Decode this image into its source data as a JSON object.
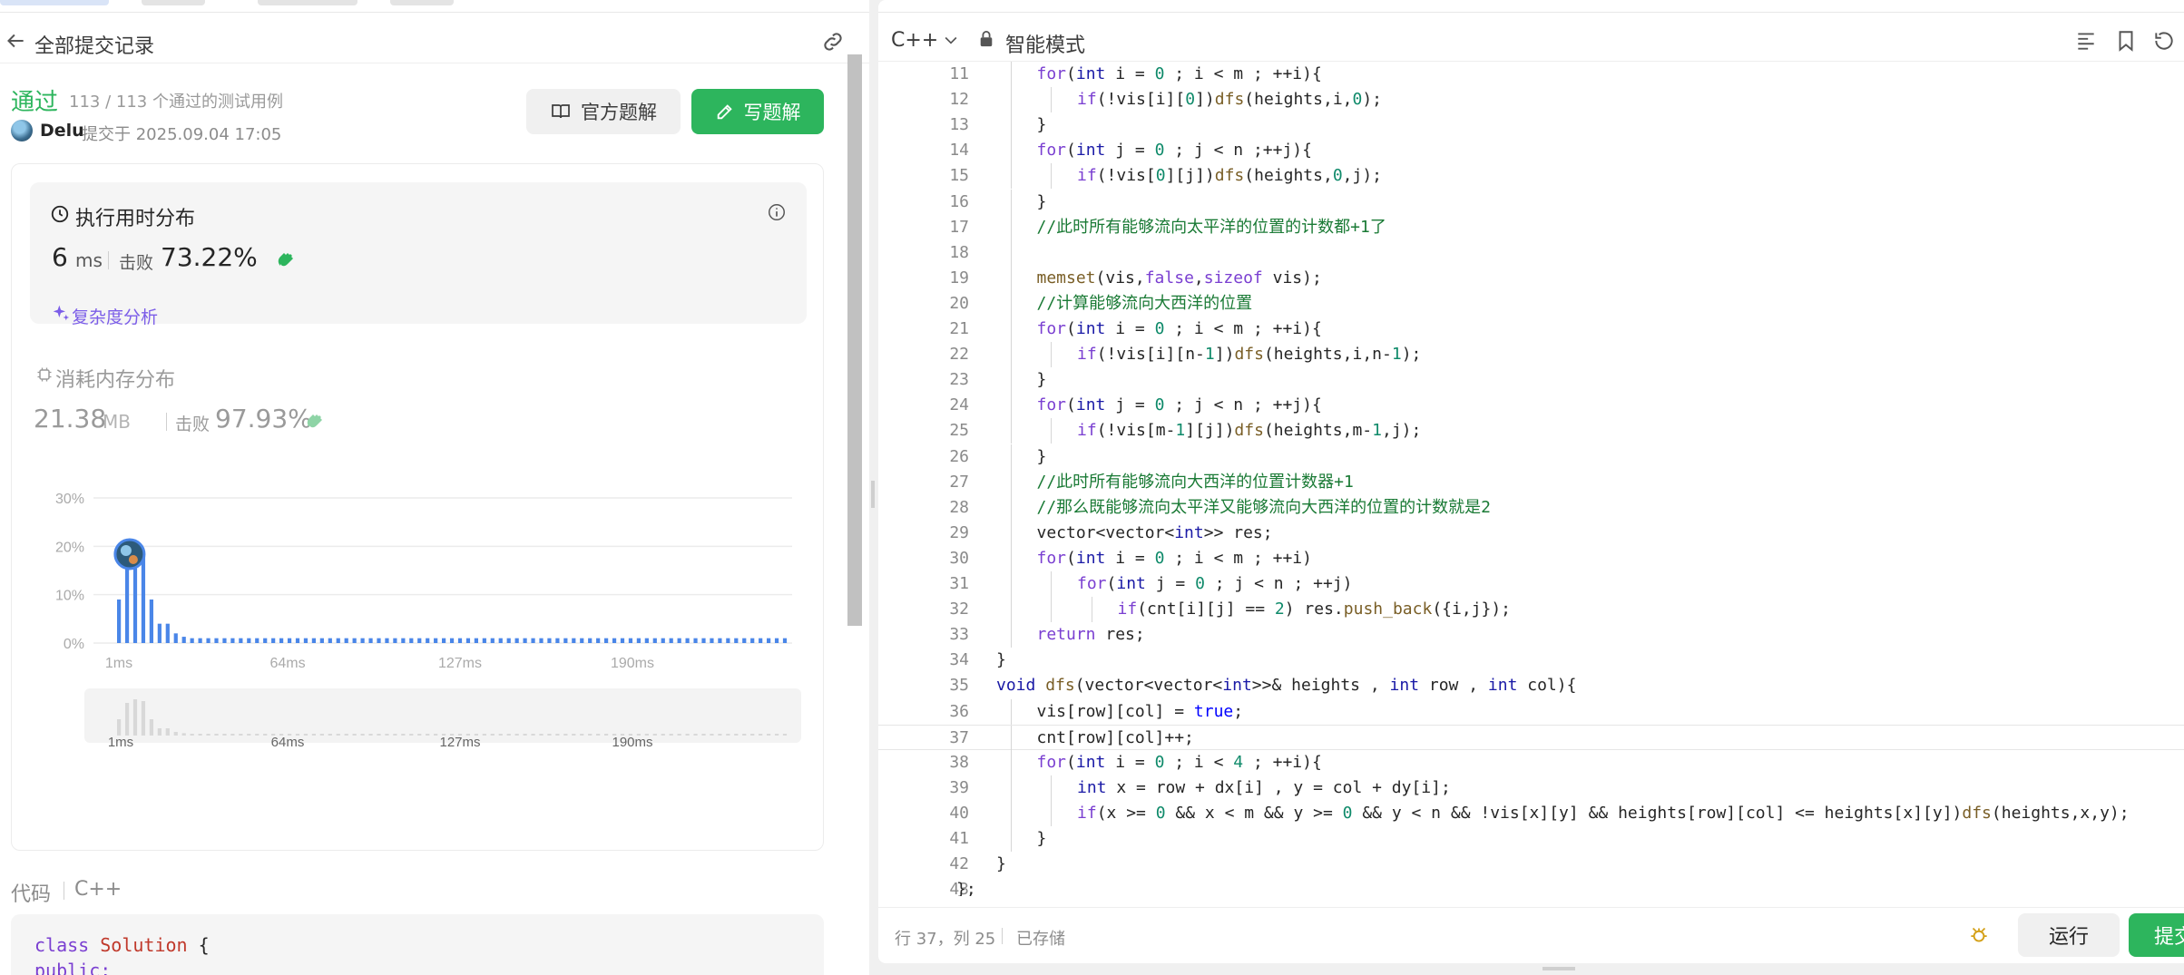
{
  "left": {
    "header_title": "全部提交记录",
    "status": "通过",
    "cases": "113 / 113 个通过的测试用例",
    "user": "Delu",
    "submitted": "提交于 2025.09.04 17:05",
    "btn_official": "官方题解",
    "btn_write": "写题解",
    "runtime": {
      "title": "执行用时分布",
      "value": "6",
      "unit": "ms",
      "beat_label": "击败",
      "beat_pct": "73.22%",
      "complexity": "复杂度分析"
    },
    "memory": {
      "title": "消耗内存分布",
      "value": "21.38",
      "unit": "MB",
      "beat_label": "击败",
      "beat_pct": "97.93%"
    },
    "code_label": "代码",
    "code_lang": "C++",
    "code_preview": [
      "class Solution {",
      "public:"
    ]
  },
  "chart_data": {
    "type": "bar",
    "title": "",
    "xlabel": "",
    "ylabel": "",
    "ylim": [
      0,
      30
    ],
    "y_ticks": [
      "30%",
      "20%",
      "10%",
      "0%"
    ],
    "x_ticks": [
      "1ms",
      "64ms",
      "127ms",
      "190ms"
    ],
    "x_min": 1,
    "x_max": 250,
    "bar_color": "#4a86e8",
    "highlight_ms": 6,
    "values": [
      9,
      18,
      20,
      19,
      9,
      4,
      4,
      2,
      1.3,
      1,
      1,
      1,
      1,
      1,
      1,
      1,
      1,
      1,
      1,
      1,
      1,
      1,
      1,
      1,
      1,
      1,
      1,
      1,
      1,
      1,
      1,
      1,
      1,
      1,
      1,
      1,
      1,
      1,
      1,
      1,
      1,
      1,
      1,
      1,
      1,
      1,
      1,
      1,
      1,
      1,
      1,
      1,
      1,
      1,
      1,
      1,
      1,
      1,
      1,
      1,
      1,
      1,
      1,
      1,
      1,
      1,
      1,
      1,
      1,
      1,
      1,
      1,
      1,
      1,
      1,
      1,
      1,
      1,
      1,
      1,
      1,
      1,
      1
    ],
    "overview_x_ticks": [
      "1ms",
      "64ms",
      "127ms",
      "190ms"
    ]
  },
  "editor": {
    "language": "C++",
    "mode": "智能模式",
    "status_position": "行 37，列 25",
    "status_saved": "已存储",
    "btn_run": "运行",
    "btn_submit": "提交",
    "active_line": 37,
    "lines": [
      {
        "n": "11",
        "indent": 2,
        "parts": [
          [
            "kw",
            "for"
          ],
          [
            "t",
            "("
          ],
          [
            "typ",
            "int"
          ],
          [
            "t",
            " i = "
          ],
          [
            "num",
            "0"
          ],
          [
            "t",
            " ; i < m ; ++i){"
          ]
        ]
      },
      {
        "n": "12",
        "indent": 3,
        "parts": [
          [
            "kw",
            "if"
          ],
          [
            "t",
            "(!vis[i]["
          ],
          [
            "num",
            "0"
          ],
          [
            "t",
            "])"
          ],
          [
            "fn",
            "dfs"
          ],
          [
            "t",
            "(heights,i,"
          ],
          [
            "num",
            "0"
          ],
          [
            "t",
            ");"
          ]
        ]
      },
      {
        "n": "13",
        "indent": 2,
        "parts": [
          [
            "t",
            "}"
          ]
        ]
      },
      {
        "n": "14",
        "indent": 2,
        "parts": [
          [
            "kw",
            "for"
          ],
          [
            "t",
            "("
          ],
          [
            "typ",
            "int"
          ],
          [
            "t",
            " j = "
          ],
          [
            "num",
            "0"
          ],
          [
            "t",
            " ; j < n ;++j){"
          ]
        ]
      },
      {
        "n": "15",
        "indent": 3,
        "parts": [
          [
            "kw",
            "if"
          ],
          [
            "t",
            "(!vis["
          ],
          [
            "num",
            "0"
          ],
          [
            "t",
            "][j])"
          ],
          [
            "fn",
            "dfs"
          ],
          [
            "t",
            "(heights,"
          ],
          [
            "num",
            "0"
          ],
          [
            "t",
            ",j);"
          ]
        ]
      },
      {
        "n": "16",
        "indent": 2,
        "parts": [
          [
            "t",
            "}"
          ]
        ]
      },
      {
        "n": "17",
        "indent": 2,
        "parts": [
          [
            "cm",
            "//此时所有能够流向太平洋的位置的计数都+1了"
          ]
        ]
      },
      {
        "n": "18",
        "indent": 2,
        "parts": []
      },
      {
        "n": "19",
        "indent": 2,
        "parts": [
          [
            "fn",
            "memset"
          ],
          [
            "t",
            "(vis,"
          ],
          [
            "kw",
            "false"
          ],
          [
            "t",
            ","
          ],
          [
            "kw",
            "sizeof"
          ],
          [
            "t",
            " vis);"
          ]
        ]
      },
      {
        "n": "20",
        "indent": 2,
        "parts": [
          [
            "cm",
            "//计算能够流向大西洋的位置"
          ]
        ]
      },
      {
        "n": "21",
        "indent": 2,
        "parts": [
          [
            "kw",
            "for"
          ],
          [
            "t",
            "("
          ],
          [
            "typ",
            "int"
          ],
          [
            "t",
            " i = "
          ],
          [
            "num",
            "0"
          ],
          [
            "t",
            " ; i < m ; ++i){"
          ]
        ]
      },
      {
        "n": "22",
        "indent": 3,
        "parts": [
          [
            "kw",
            "if"
          ],
          [
            "t",
            "(!vis[i][n-"
          ],
          [
            "num",
            "1"
          ],
          [
            "t",
            "])"
          ],
          [
            "fn",
            "dfs"
          ],
          [
            "t",
            "(heights,i,n-"
          ],
          [
            "num",
            "1"
          ],
          [
            "t",
            ");"
          ]
        ]
      },
      {
        "n": "23",
        "indent": 2,
        "parts": [
          [
            "t",
            "}"
          ]
        ]
      },
      {
        "n": "24",
        "indent": 2,
        "parts": [
          [
            "kw",
            "for"
          ],
          [
            "t",
            "("
          ],
          [
            "typ",
            "int"
          ],
          [
            "t",
            " j = "
          ],
          [
            "num",
            "0"
          ],
          [
            "t",
            " ; j < n ; ++j){"
          ]
        ]
      },
      {
        "n": "25",
        "indent": 3,
        "parts": [
          [
            "kw",
            "if"
          ],
          [
            "t",
            "(!vis[m-"
          ],
          [
            "num",
            "1"
          ],
          [
            "t",
            "][j])"
          ],
          [
            "fn",
            "dfs"
          ],
          [
            "t",
            "(heights,m-"
          ],
          [
            "num",
            "1"
          ],
          [
            "t",
            ",j);"
          ]
        ]
      },
      {
        "n": "26",
        "indent": 2,
        "parts": [
          [
            "t",
            "}"
          ]
        ]
      },
      {
        "n": "27",
        "indent": 2,
        "parts": [
          [
            "cm",
            "//此时所有能够流向大西洋的位置计数器+1"
          ]
        ]
      },
      {
        "n": "28",
        "indent": 2,
        "parts": [
          [
            "cm",
            "//那么既能够流向太平洋又能够流向大西洋的位置的计数就是2"
          ]
        ]
      },
      {
        "n": "29",
        "indent": 2,
        "parts": [
          [
            "t",
            "vector<vector<"
          ],
          [
            "typ",
            "int"
          ],
          [
            "t",
            ">> res;"
          ]
        ]
      },
      {
        "n": "30",
        "indent": 2,
        "parts": [
          [
            "kw",
            "for"
          ],
          [
            "t",
            "("
          ],
          [
            "typ",
            "int"
          ],
          [
            "t",
            " i = "
          ],
          [
            "num",
            "0"
          ],
          [
            "t",
            " ; i < m ; ++i)"
          ]
        ]
      },
      {
        "n": "31",
        "indent": 3,
        "parts": [
          [
            "kw",
            "for"
          ],
          [
            "t",
            "("
          ],
          [
            "typ",
            "int"
          ],
          [
            "t",
            " j = "
          ],
          [
            "num",
            "0"
          ],
          [
            "t",
            " ; j < n ; ++j)"
          ]
        ]
      },
      {
        "n": "32",
        "indent": 4,
        "parts": [
          [
            "kw",
            "if"
          ],
          [
            "t",
            "(cnt[i][j] == "
          ],
          [
            "num",
            "2"
          ],
          [
            "t",
            ") res."
          ],
          [
            "fn",
            "push_back"
          ],
          [
            "t",
            "({i,j});"
          ]
        ]
      },
      {
        "n": "33",
        "indent": 2,
        "parts": [
          [
            "kw",
            "return"
          ],
          [
            "t",
            " res;"
          ]
        ]
      },
      {
        "n": "34",
        "indent": 1,
        "parts": [
          [
            "t",
            "}"
          ]
        ]
      },
      {
        "n": "35",
        "indent": 1,
        "parts": [
          [
            "typ",
            "void"
          ],
          [
            "t",
            " "
          ],
          [
            "fn",
            "dfs"
          ],
          [
            "t",
            "(vector<vector<"
          ],
          [
            "typ",
            "int"
          ],
          [
            "t",
            ">>& heights , "
          ],
          [
            "typ",
            "int"
          ],
          [
            "t",
            " row , "
          ],
          [
            "typ",
            "int"
          ],
          [
            "t",
            " col){"
          ]
        ]
      },
      {
        "n": "36",
        "indent": 2,
        "parts": [
          [
            "t",
            "vis[row][col] = "
          ],
          [
            "bool",
            "true"
          ],
          [
            "t",
            ";"
          ]
        ]
      },
      {
        "n": "37",
        "indent": 2,
        "parts": [
          [
            "t",
            "cnt[row][col]++;"
          ]
        ]
      },
      {
        "n": "38",
        "indent": 2,
        "parts": [
          [
            "kw",
            "for"
          ],
          [
            "t",
            "("
          ],
          [
            "typ",
            "int"
          ],
          [
            "t",
            " i = "
          ],
          [
            "num",
            "0"
          ],
          [
            "t",
            " ; i < "
          ],
          [
            "num",
            "4"
          ],
          [
            "t",
            " ; ++i){"
          ]
        ]
      },
      {
        "n": "39",
        "indent": 3,
        "parts": [
          [
            "typ",
            "int"
          ],
          [
            "t",
            " x = row + dx[i] , y = col + dy[i];"
          ]
        ]
      },
      {
        "n": "40",
        "indent": 3,
        "parts": [
          [
            "kw",
            "if"
          ],
          [
            "t",
            "(x >= "
          ],
          [
            "num",
            "0"
          ],
          [
            "t",
            " && x < m && y >= "
          ],
          [
            "num",
            "0"
          ],
          [
            "t",
            " && y < n && !vis[x][y] && heights[row][col] <= heights[x][y])"
          ],
          [
            "fn",
            "dfs"
          ],
          [
            "t",
            "(heights,x,y);"
          ]
        ]
      },
      {
        "n": "41",
        "indent": 2,
        "parts": [
          [
            "t",
            "}"
          ]
        ]
      },
      {
        "n": "42",
        "indent": 1,
        "parts": [
          [
            "t",
            "}"
          ]
        ]
      },
      {
        "n": "43",
        "indent": 0,
        "parts": [
          [
            "t",
            "};"
          ]
        ]
      }
    ]
  }
}
